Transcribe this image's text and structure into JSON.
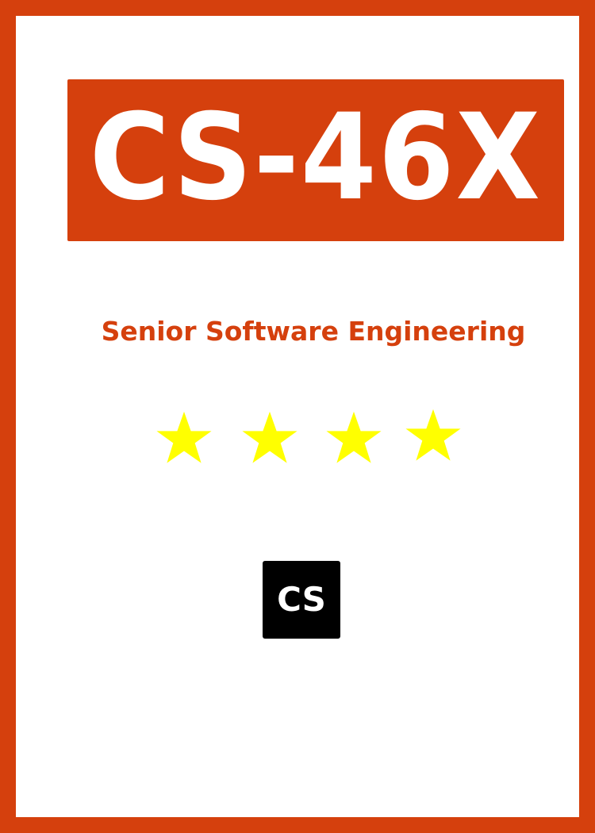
{
  "card": {
    "course_code": "CS-46X",
    "course_title": "Senior Software Engineering",
    "badge_text": "CS"
  },
  "rating": {
    "stars_shown": 4,
    "star_icon": "star-icon",
    "star_color": "#ffff00"
  },
  "colors": {
    "accent": "#d5400d",
    "background": "#ffffff",
    "badge_background": "#000000",
    "badge_text": "#ffffff"
  }
}
